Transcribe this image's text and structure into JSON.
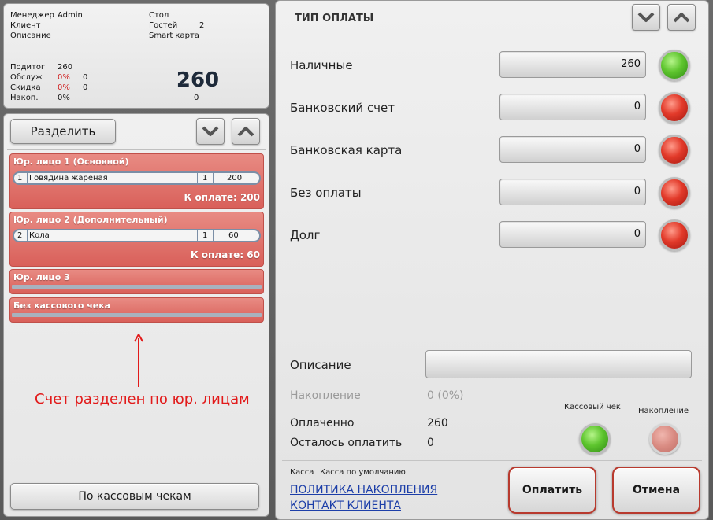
{
  "info": {
    "manager_label": "Менеджер",
    "manager_value": "Admin",
    "client_label": "Клиент",
    "description_label": "Описание",
    "table_label": "Стол",
    "guests_label": "Гостей",
    "guests_value": "2",
    "card_label": "Smart карта",
    "subtotal_label": "Подитог",
    "subtotal_value": "260",
    "service_label": "Обслуж",
    "service_pct": "0%",
    "service_value": "0",
    "discount_label": "Скидка",
    "discount_pct": "0%",
    "discount_value": "0",
    "accum_label": "Накоп.",
    "accum_pct": "0%",
    "accum_value": "0",
    "total": "260"
  },
  "split": {
    "split_button": "Разделить",
    "bottom_button": "По кассовым чекам",
    "groups": [
      {
        "title": "Юр. лицо 1 (Основной)",
        "items": [
          {
            "num": "1",
            "name": "Говядина жареная",
            "qty": "1",
            "price": "200"
          }
        ],
        "total": "К оплате: 200"
      },
      {
        "title": "Юр. лицо 2 (Дополнительный)",
        "items": [
          {
            "num": "2",
            "name": "Кола",
            "qty": "1",
            "price": "60"
          }
        ],
        "total": "К оплате: 60"
      },
      {
        "title": "Юр. лицо 3",
        "items": [],
        "total": ""
      },
      {
        "title": "Без кассового чека",
        "items": [],
        "total": ""
      }
    ],
    "annotation": "Счет разделен по юр. лицам",
    "annotation_color": "#e21a1a"
  },
  "payment": {
    "title": "ТИП ОПЛАТЫ",
    "methods": [
      {
        "label": "Наличные",
        "value": "260",
        "status": "green"
      },
      {
        "label": "Банковский счет",
        "value": "0",
        "status": "red"
      },
      {
        "label": "Банковская карта",
        "value": "0",
        "status": "red"
      },
      {
        "label": "Без оплаты",
        "value": "0",
        "status": "red"
      },
      {
        "label": "Долг",
        "value": "0",
        "status": "red"
      }
    ],
    "description_label": "Описание",
    "accumulation_label": "Накопление",
    "accumulation_value": "0 (0%)",
    "paid_label": "Оплаченно",
    "paid_value": "260",
    "remaining_label": "Осталось оплатить",
    "remaining_value": "0",
    "receipt_label": "Кассовый чек",
    "accum_toggle_label": "Накопление",
    "cashdesk_label": "Касса",
    "cashdesk_value": "Касса по умолчанию",
    "link_policy": "ПОЛИТИКА НАКОПЛЕНИЯ",
    "link_contact": "КОНТАКТ КЛИЕНТА",
    "pay_button": "Оплатить",
    "cancel_button": "Отмена"
  },
  "colors": {
    "group_red": "#d9605a",
    "led_green": "#5ec52e",
    "led_red": "#e23a2a",
    "link_blue": "#1c3ea8"
  },
  "icons": {
    "scroll_down": "chevron-down-icon",
    "scroll_up": "chevron-up-icon",
    "annotation_arrow": "arrow-up-icon"
  }
}
